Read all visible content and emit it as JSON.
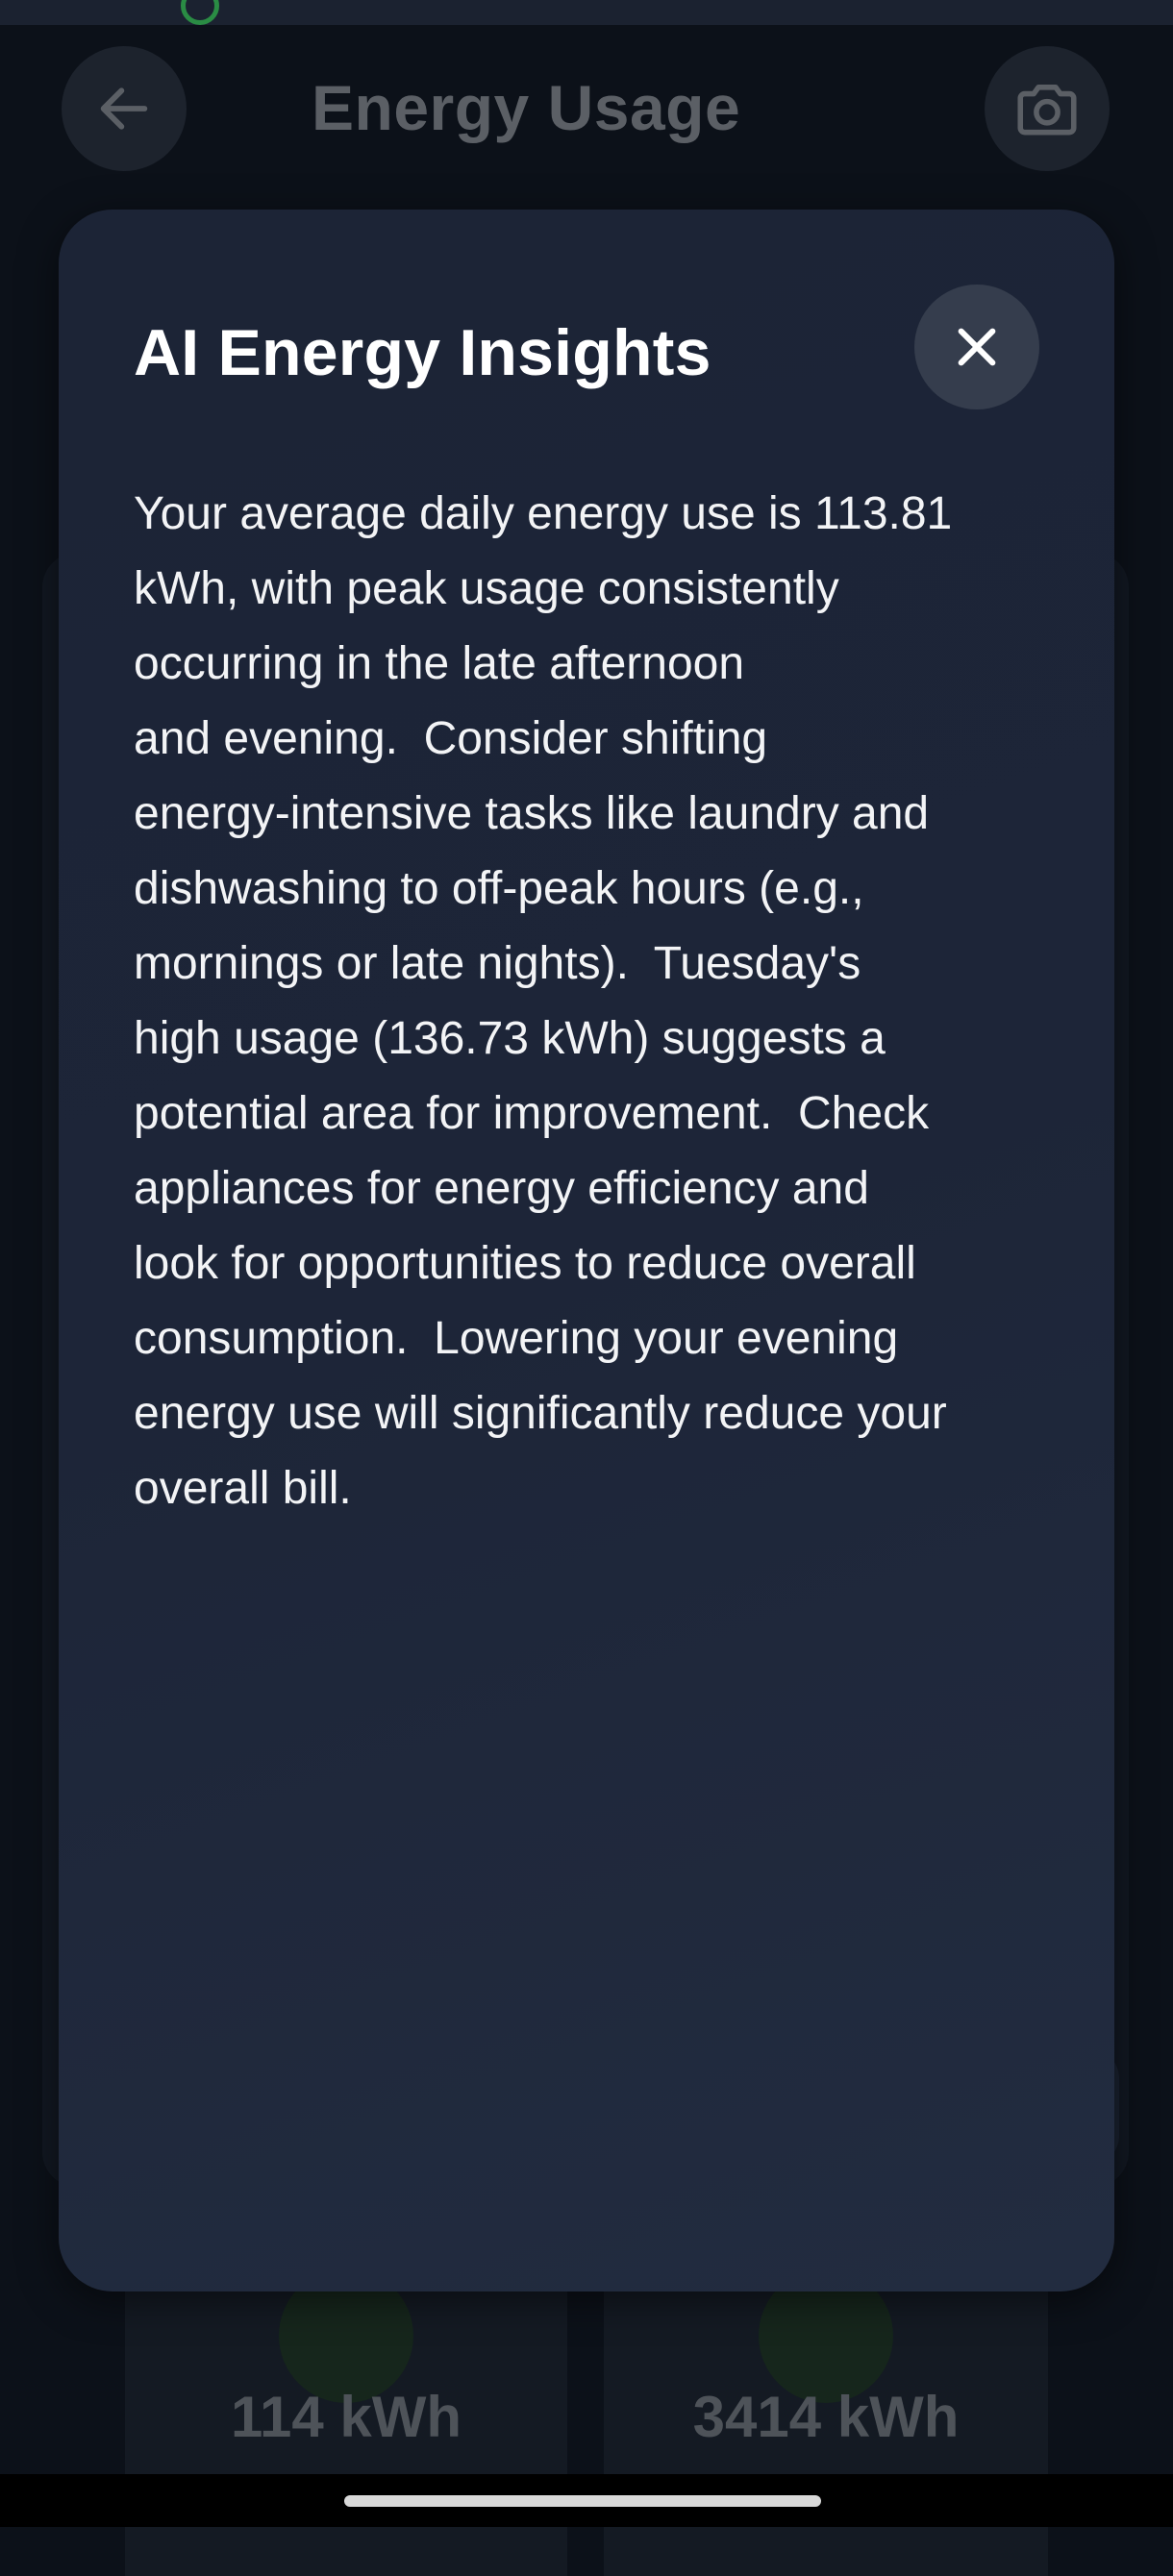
{
  "app_bar": {
    "title": "Energy Usage",
    "back_icon": "arrow-left-icon",
    "camera_icon": "camera-icon"
  },
  "stats": [
    {
      "value": "114 kWh"
    },
    {
      "value": "3414 kWh"
    }
  ],
  "modal": {
    "title": "AI Energy Insights",
    "close_icon": "close-icon",
    "body": "Your average daily energy use is 113.81\nkWh, with peak usage consistently\noccurring in the late afternoon\nand evening.  Consider shifting\nenergy-intensive tasks like laundry and\ndishwashing to off-peak hours (e.g.,\nmornings or late nights).  Tuesday's\nhigh usage (136.73 kWh) suggests a\npotential area for improvement.  Check\nappliances for energy efficiency and\nlook for opportunities to reduce overall\nconsumption.  Lowering your evening\nenergy use will significantly reduce your\noverall bill."
  },
  "colors": {
    "background": "#0c1119",
    "modal": "#1d2538",
    "close_button": "#353d4d",
    "text_primary": "#ffffff",
    "text_dimmed": "#5b5f65",
    "status_accent": "#2ea84a"
  }
}
